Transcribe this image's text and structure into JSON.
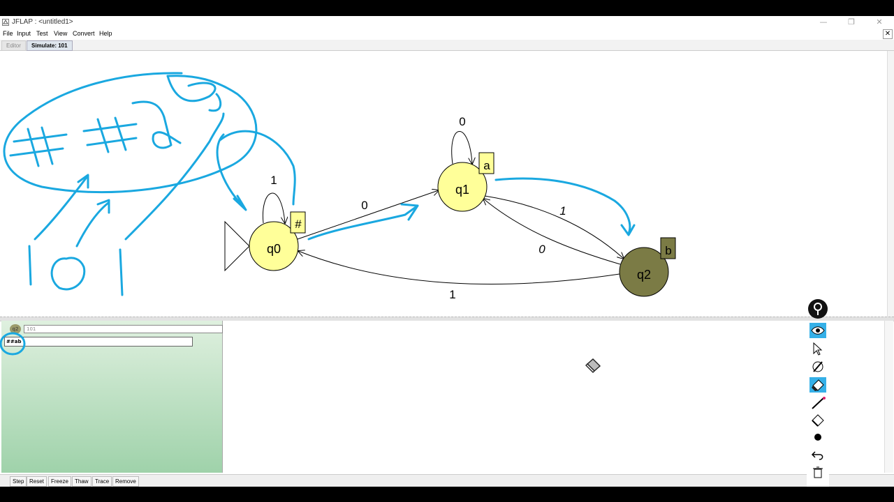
{
  "window": {
    "title": "JFLAP : <untitled1>"
  },
  "menu": [
    "File",
    "Input",
    "Test",
    "View",
    "Convert",
    "Help"
  ],
  "tabs": [
    {
      "label": "Editor",
      "active": false
    },
    {
      "label": "Simulate: 101",
      "active": true
    }
  ],
  "close_glyph": "✕",
  "automaton": {
    "states": [
      {
        "id": "q0",
        "label": "q0",
        "initial": true,
        "active": false,
        "marker": "#"
      },
      {
        "id": "q1",
        "label": "q1",
        "initial": false,
        "active": false,
        "marker": "a"
      },
      {
        "id": "q2",
        "label": "q2",
        "initial": false,
        "active": true,
        "marker": "b"
      }
    ],
    "transitions": [
      {
        "from": "q0",
        "to": "q0",
        "label": "1"
      },
      {
        "from": "q0",
        "to": "q1",
        "label": "0"
      },
      {
        "from": "q1",
        "to": "q1",
        "label": "0"
      },
      {
        "from": "q1",
        "to": "q2",
        "label": "1"
      },
      {
        "from": "q2",
        "to": "q1",
        "label": "0"
      },
      {
        "from": "q2",
        "to": "q0",
        "label": "1"
      }
    ]
  },
  "configuration": {
    "state_label": "q2",
    "input": "101",
    "tape": "##ab"
  },
  "buttons": [
    "Step",
    "Reset",
    "Freeze",
    "Thaw",
    "Trace",
    "Remove"
  ],
  "pen_tools": [
    "eye-icon",
    "pointer-icon",
    "pen-icon",
    "highlighter-icon",
    "line-icon",
    "eraser-icon",
    "dot-icon",
    "undo-icon",
    "trash-icon"
  ],
  "colors": {
    "state_fill": "#ffff99",
    "active_state_fill": "#7b7b45",
    "annotation": "#1aa8e0",
    "config_pane": "#a8d8b0"
  }
}
